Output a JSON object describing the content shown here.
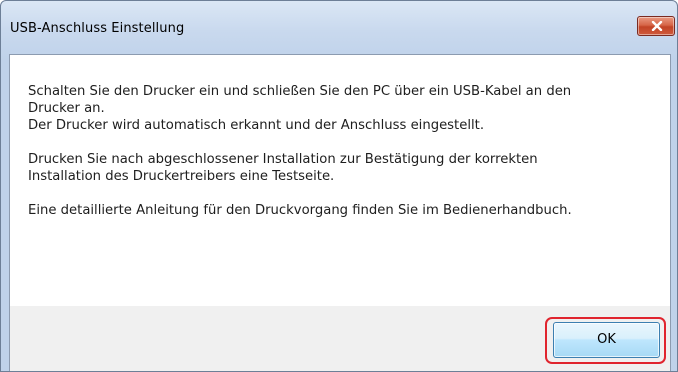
{
  "dialog": {
    "title": "USB-Anschluss Einstellung",
    "close_icon": "close-icon",
    "message": {
      "line1": "Schalten Sie den Drucker ein und schließen Sie den PC über ein USB-Kabel an den",
      "line2": "Drucker an.",
      "line3": "Der Drucker wird automatisch erkannt und der Anschluss eingestellt.",
      "line4": "Drucken Sie nach abgeschlossener Installation zur Bestätigung der korrekten",
      "line5": "Installation des Druckertreibers eine Testseite.",
      "line6": "Eine detaillierte Anleitung für den Druckvorgang finden Sie im Bedienerhandbuch."
    },
    "ok_label": "OK"
  },
  "colors": {
    "highlight": "#e0242e",
    "close_button": "#c24325"
  }
}
